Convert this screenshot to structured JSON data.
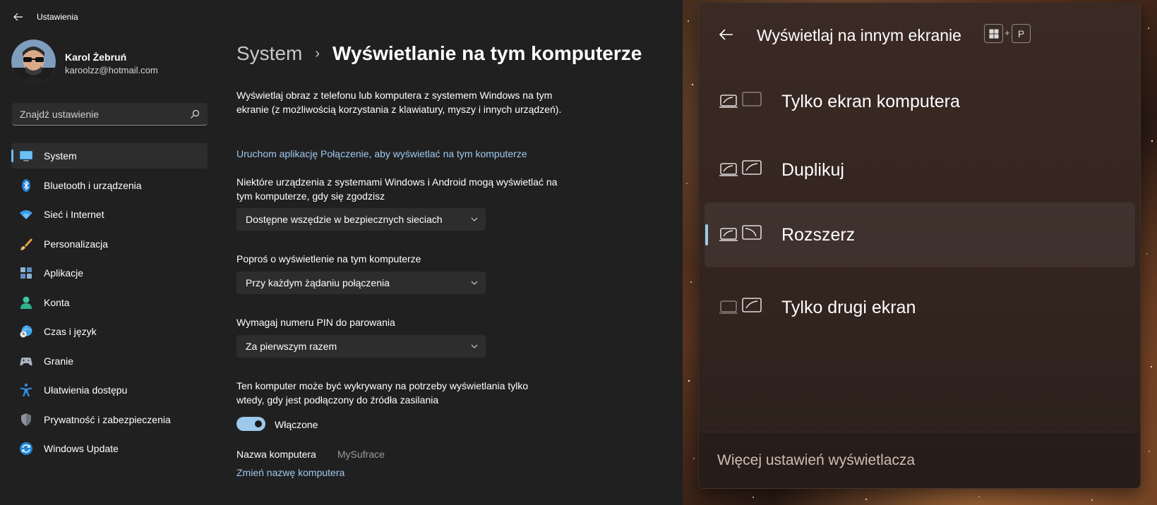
{
  "window": {
    "app_title": "Ustawienia"
  },
  "profile": {
    "name": "Karol Żebruń",
    "email": "karoolzz@hotmail.com"
  },
  "search": {
    "placeholder": "Znajdź ustawienie"
  },
  "sidebar": {
    "items": [
      {
        "label": "System",
        "icon": "monitor-icon",
        "active": true
      },
      {
        "label": "Bluetooth i urządzenia",
        "icon": "bluetooth-icon"
      },
      {
        "label": "Sieć i Internet",
        "icon": "wifi-icon"
      },
      {
        "label": "Personalizacja",
        "icon": "brush-icon"
      },
      {
        "label": "Aplikacje",
        "icon": "apps-icon"
      },
      {
        "label": "Konta",
        "icon": "person-icon"
      },
      {
        "label": "Czas i język",
        "icon": "globe-clock-icon"
      },
      {
        "label": "Granie",
        "icon": "gamepad-icon"
      },
      {
        "label": "Ułatwienia dostępu",
        "icon": "accessibility-icon"
      },
      {
        "label": "Prywatność i zabezpieczenia",
        "icon": "shield-icon"
      },
      {
        "label": "Windows Update",
        "icon": "update-icon"
      }
    ]
  },
  "header": {
    "parent": "System",
    "separator": "›",
    "current": "Wyświetlanie na tym komputerze"
  },
  "main": {
    "intro": "Wyświetlaj obraz z telefonu lub komputera z systemem Windows na tym ekranie (z możliwością korzystania z klawiatury, myszy i innych urządzeń).",
    "launch_link": "Uruchom aplikację Połączenie, aby wyświetlać na tym komputerze",
    "setting1_label": "Niektóre urządzenia z systemami Windows i Android mogą wyświetlać na tym komputerze, gdy się zgodzisz",
    "setting1_value": "Dostępne wszędzie w bezpiecznych sieciach",
    "setting2_label": "Poproś o wyświetlenie na tym komputerze",
    "setting2_value": "Przy każdym żądaniu połączenia",
    "setting3_label": "Wymagaj numeru PIN do parowania",
    "setting3_value": "Za pierwszym razem",
    "power_label": "Ten komputer może być wykrywany na potrzeby wyświetlania tylko wtedy, gdy jest podłączony do źródła zasilania",
    "toggle_label": "Włączone",
    "toggle_on": true,
    "pc_name_key": "Nazwa komputera",
    "pc_name_value": "MySufrace",
    "rename_link": "Zmień nazwę komputera"
  },
  "flyout": {
    "title": "Wyświetlaj na innym ekranie",
    "shortcut": {
      "key1_icon": "windows-key-icon",
      "plus": "+",
      "key2": "P"
    },
    "options": [
      {
        "label": "Tylko ekran komputera",
        "icon": "pc-screen-only-icon"
      },
      {
        "label": "Duplikuj",
        "icon": "duplicate-icon"
      },
      {
        "label": "Rozszerz",
        "icon": "extend-icon",
        "active": true
      },
      {
        "label": "Tylko drugi ekran",
        "icon": "second-screen-only-icon"
      }
    ],
    "footer_link": "Więcej ustawień wyświetlacza"
  },
  "colors": {
    "accent": "#9cc9ec",
    "link": "#9fc8ef",
    "background": "#202020",
    "surface": "#2d2d2d"
  }
}
